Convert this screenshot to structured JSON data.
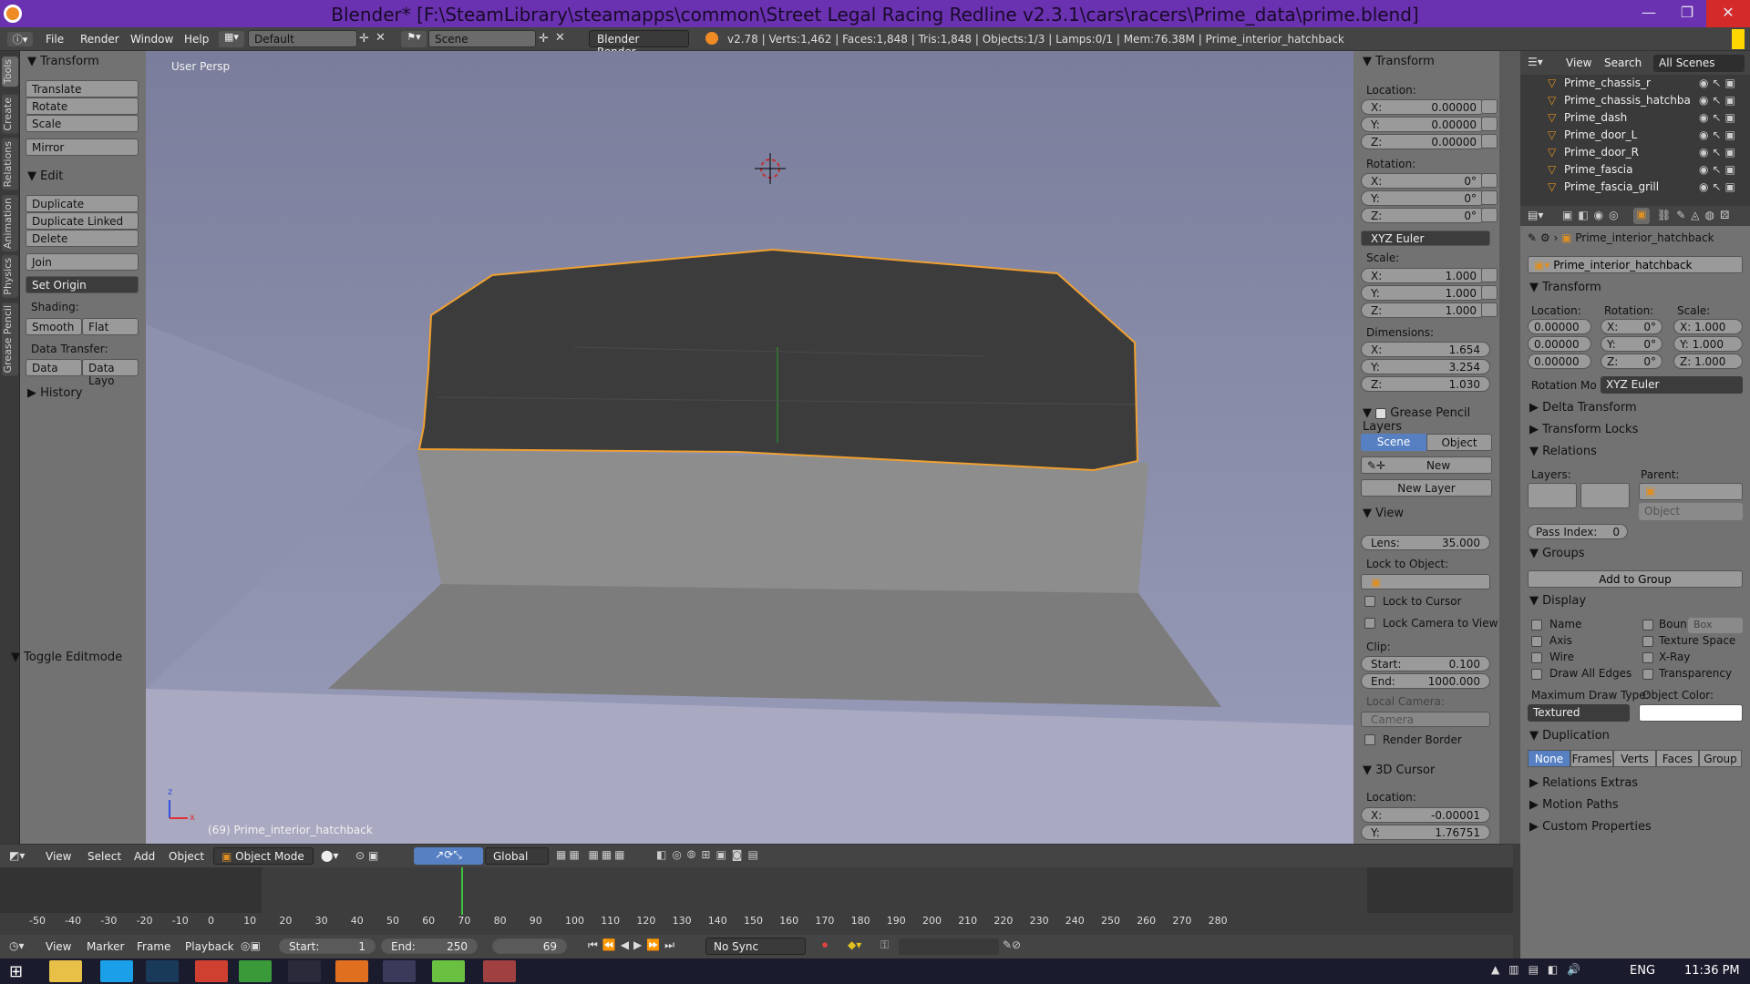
{
  "window": {
    "title": "Blender* [F:\\SteamLibrary\\steamapps\\common\\Street Legal Racing Redline v2.3.1\\cars\\racers\\Prime_data\\prime.blend]",
    "controls": [
      "—",
      "❐",
      "✕"
    ]
  },
  "topbar": {
    "menus": [
      "File",
      "Render",
      "Window",
      "Help"
    ],
    "layout": "Default",
    "scene": "Scene",
    "engine": "Blender Render",
    "stats": "v2.78 | Verts:1,462 | Faces:1,848 | Tris:1,848 | Objects:1/3 | Lamps:0/1 | Mem:76.38M | Prime_interior_hatchback"
  },
  "tool_tabs": [
    "Tools",
    "Create",
    "Relations",
    "Animation",
    "Physics",
    "Grease Pencil"
  ],
  "toolshelf": {
    "transform_header": "Transform",
    "transform_buttons": [
      "Translate",
      "Rotate",
      "Scale",
      "Mirror"
    ],
    "edit_header": "Edit",
    "edit_buttons": [
      "Duplicate",
      "Duplicate Linked",
      "Delete",
      "Join",
      "Set Origin"
    ],
    "shading_label": "Shading:",
    "shading_smooth": "Smooth",
    "shading_flat": "Flat",
    "data_transfer_label": "Data Transfer:",
    "data_btn": "Data",
    "data_layo_btn": "Data Layo",
    "history_header": "History",
    "toggle_editmode": "Toggle Editmode"
  },
  "viewport": {
    "view_name": "User Persp",
    "object_label": "(69) Prime_interior_hatchback",
    "axis_z": "z",
    "axis_x": "x"
  },
  "npanel": {
    "transform_header": "Transform",
    "location_label": "Location:",
    "location": [
      "X:",
      "0.00000",
      "Y:",
      "0.00000",
      "Z:",
      "0.00000"
    ],
    "rotation_label": "Rotation:",
    "rotation": [
      "X:",
      "0°",
      "Y:",
      "0°",
      "Z:",
      "0°"
    ],
    "rotation_mode": "XYZ Euler",
    "scale_label": "Scale:",
    "scale": [
      "X:",
      "1.000",
      "Y:",
      "1.000",
      "Z:",
      "1.000"
    ],
    "dimensions_label": "Dimensions:",
    "dimensions": [
      "X:",
      "1.654",
      "Y:",
      "3.254",
      "Z:",
      "1.030"
    ],
    "gp_header": "Grease Pencil Layers",
    "gp_scene": "Scene",
    "gp_object": "Object",
    "gp_new": "New",
    "gp_new_layer": "New Layer",
    "view_header": "View",
    "lens_label": "Lens:",
    "lens_value": "35.000",
    "lock_to_object": "Lock to Object:",
    "lock_to_cursor": "Lock to Cursor",
    "lock_camera": "Lock Camera to View",
    "clip_label": "Clip:",
    "clip_start_label": "Start:",
    "clip_start": "0.100",
    "clip_end_label": "End:",
    "clip_end": "1000.000",
    "local_camera": "Local Camera:",
    "camera": "Camera",
    "render_border": "Render Border",
    "cursor_header": "3D Cursor",
    "cursor_location": "Location:",
    "cursor_x_label": "X:",
    "cursor_x": "-0.00001",
    "cursor_y_label": "Y:",
    "cursor_y": "1.76751"
  },
  "outliner": {
    "view": "View",
    "search": "Search",
    "scenes": "All Scenes",
    "items": [
      "Prime_chassis_r",
      "Prime_chassis_hatchba",
      "Prime_dash",
      "Prime_door_L",
      "Prime_door_R",
      "Prime_fascia",
      "Prime_fascia_grill"
    ]
  },
  "properties": {
    "object_name_breadcrumb": "Prime_interior_hatchback",
    "object_name": "Prime_interior_hatchback",
    "transform_header": "Transform",
    "location_label": "Location:",
    "rotation_label": "Rotation:",
    "scale_label": "Scale:",
    "loc": [
      "0.00000",
      "0.00000",
      "0.00000"
    ],
    "rot": [
      "X:",
      "0°",
      "Y:",
      "0°",
      "Z:",
      "0°"
    ],
    "scl": [
      "X: 1.000",
      "Y: 1.000",
      "Z: 1.000"
    ],
    "rotation_mode_label": "Rotation Mo",
    "rotation_mode": "XYZ Euler",
    "delta_transform": "Delta Transform",
    "transform_locks": "Transform Locks",
    "relations": "Relations",
    "layers_label": "Layers:",
    "parent_label": "Parent:",
    "parent_type": "Object",
    "pass_index_label": "Pass Index:",
    "pass_index": "0",
    "groups": "Groups",
    "add_to_group": "Add to Group",
    "display": "Display",
    "display_opts": [
      "Name",
      "Axis",
      "Wire",
      "Draw All Edges"
    ],
    "display_opts2": [
      "Boun",
      "Texture Space",
      "X-Ray",
      "Transparency"
    ],
    "bound_type": "Box",
    "max_draw_type_label": "Maximum Draw Type:",
    "object_color_label": "Object Color:",
    "max_draw_type": "Textured",
    "duplication": "Duplication",
    "dup_opts": [
      "None",
      "Frames",
      "Verts",
      "Faces",
      "Group"
    ],
    "relations_extras": "Relations Extras",
    "motion_paths": "Motion Paths",
    "custom_properties": "Custom Properties"
  },
  "view_header": {
    "menus": [
      "View",
      "Select",
      "Add",
      "Object"
    ],
    "mode": "Object Mode",
    "orientation": "Global"
  },
  "timeline": {
    "ticks": [
      "-50",
      "-40",
      "-30",
      "-20",
      "-10",
      "0",
      "10",
      "20",
      "30",
      "40",
      "50",
      "60",
      "70",
      "80",
      "90",
      "100",
      "110",
      "120",
      "130",
      "140",
      "150",
      "160",
      "170",
      "180",
      "190",
      "200",
      "210",
      "220",
      "230",
      "240",
      "250",
      "260",
      "270",
      "280"
    ],
    "current_frame": 69,
    "menus": [
      "View",
      "Marker",
      "Frame",
      "Playback"
    ],
    "start_label": "Start:",
    "start": "1",
    "end_label": "End:",
    "end": "250",
    "frame": "69",
    "sync": "No Sync"
  },
  "taskbar": {
    "lang": "ENG",
    "time": "11:36 PM"
  },
  "colors": {
    "title_bg": "#6a32b0",
    "panel": "#727272",
    "accent_blue": "#5680c2",
    "selection_outline": "#f0a030"
  }
}
